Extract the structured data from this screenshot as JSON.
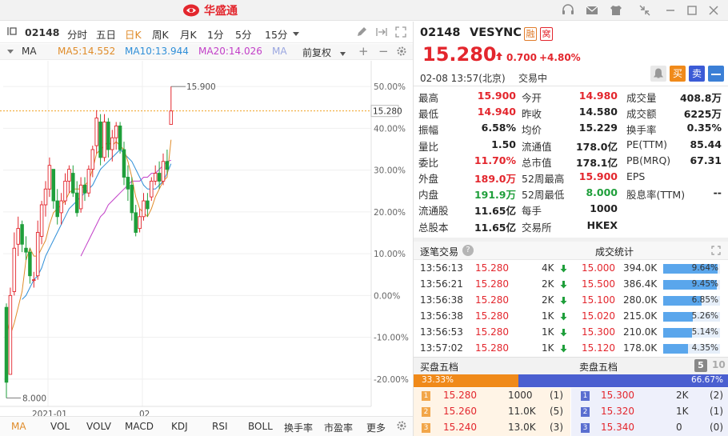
{
  "app": {
    "logo_text": "华盛通"
  },
  "toolbar": {
    "code": "02148",
    "periods": [
      "分时",
      "五日",
      "日K",
      "周K",
      "月K",
      "1分",
      "5分",
      "15分"
    ],
    "active_period": "日K"
  },
  "ma_bar": {
    "label": "MA",
    "ma5": "MA5:14.552",
    "ma10": "MA10:13.944",
    "ma20": "MA20:14.026",
    "ma_more": "MA",
    "adjust": "前复权",
    "colors": {
      "ma5": "#e08c2a",
      "ma10": "#2f8fd8",
      "ma20": "#c23fc8",
      "up": "#e3262d",
      "down": "#1f9f3b"
    }
  },
  "chart_data": {
    "type": "candlestick",
    "price_high_label": "15.900",
    "price_low_label": "8.000",
    "current_price_label": "15.280",
    "y_ticks": [
      "50.00%",
      "40.00%",
      "30.00%",
      "20.00%",
      "10.00%",
      "0.00%",
      "-10.00%",
      "-20.00%"
    ],
    "x_ticks": [
      "2021-01",
      "02"
    ],
    "candles": [
      [
        10.3,
        10.4,
        8.0,
        8.4
      ],
      [
        8.6,
        10.8,
        8.6,
        10.6
      ],
      [
        10.7,
        12.2,
        10.6,
        11.8
      ],
      [
        11.9,
        12.6,
        11.6,
        12.3
      ],
      [
        12.4,
        12.5,
        11.7,
        11.9
      ],
      [
        11.8,
        12.1,
        11.5,
        11.7
      ],
      [
        11.7,
        11.8,
        10.9,
        11.1
      ],
      [
        11.0,
        11.2,
        10.8,
        11.0
      ],
      [
        11.1,
        12.5,
        11.0,
        12.2
      ],
      [
        12.1,
        13.0,
        11.9,
        12.9
      ],
      [
        12.9,
        13.5,
        12.6,
        13.3
      ],
      [
        13.3,
        14.1,
        13.1,
        13.9
      ],
      [
        13.8,
        13.8,
        12.8,
        13.0
      ],
      [
        13.0,
        13.3,
        12.4,
        12.6
      ],
      [
        12.7,
        13.2,
        12.4,
        13.0
      ],
      [
        13.0,
        13.7,
        12.9,
        13.5
      ],
      [
        13.5,
        13.9,
        13.2,
        13.8
      ],
      [
        13.7,
        13.9,
        13.1,
        13.2
      ],
      [
        13.2,
        13.5,
        12.6,
        12.7
      ],
      [
        12.8,
        13.6,
        12.7,
        13.4
      ],
      [
        13.4,
        13.6,
        13.0,
        13.2
      ],
      [
        13.2,
        13.9,
        13.1,
        13.8
      ],
      [
        13.8,
        14.4,
        13.6,
        14.3
      ],
      [
        14.4,
        15.3,
        14.2,
        15.1
      ],
      [
        15.0,
        15.2,
        13.9,
        14.1
      ],
      [
        14.1,
        15.2,
        14.0,
        15.0
      ],
      [
        15.0,
        15.1,
        14.1,
        14.3
      ],
      [
        14.3,
        14.8,
        14.0,
        14.6
      ],
      [
        14.6,
        15.0,
        14.3,
        14.9
      ],
      [
        14.9,
        15.0,
        14.2,
        14.3
      ],
      [
        14.3,
        14.5,
        13.4,
        13.6
      ],
      [
        13.6,
        13.9,
        13.0,
        13.3
      ],
      [
        13.4,
        13.6,
        12.5,
        12.7
      ],
      [
        12.7,
        12.9,
        12.1,
        12.2
      ],
      [
        12.3,
        12.8,
        12.2,
        12.6
      ],
      [
        12.6,
        13.2,
        12.5,
        13.0
      ],
      [
        13.0,
        13.2,
        12.6,
        12.8
      ],
      [
        13.1,
        13.6,
        13.0,
        13.5
      ],
      [
        13.5,
        13.9,
        13.4,
        13.7
      ],
      [
        13.7,
        14.0,
        13.3,
        13.5
      ],
      [
        13.5,
        14.2,
        13.4,
        14.0
      ],
      [
        14.0,
        14.3,
        13.7,
        13.8
      ],
      [
        14.94,
        15.9,
        14.94,
        15.28
      ]
    ],
    "ma5_values": [
      10.0,
      9.6,
      9.9,
      10.3,
      10.7,
      11.5,
      11.8,
      11.6,
      11.6,
      11.8,
      12.0,
      12.4,
      12.7,
      12.8,
      12.9,
      13.0,
      13.2,
      13.3,
      13.3,
      13.3,
      13.4,
      13.5,
      13.8,
      14.2,
      14.3,
      14.4,
      14.5,
      14.4,
      14.5,
      14.4,
      14.3,
      14.0,
      13.6,
      13.1,
      12.8,
      12.7,
      12.6,
      12.8,
      13.1,
      13.3,
      13.5,
      13.6,
      14.55
    ],
    "ma10_values": [
      null,
      null,
      null,
      null,
      10.5,
      10.6,
      10.8,
      11.0,
      11.1,
      11.3,
      11.6,
      11.8,
      12.0,
      12.2,
      12.4,
      12.6,
      12.8,
      12.9,
      13.0,
      13.1,
      13.2,
      13.3,
      13.4,
      13.6,
      13.8,
      13.9,
      14.0,
      14.1,
      14.2,
      14.3,
      14.2,
      14.1,
      14.0,
      13.8,
      13.6,
      13.4,
      13.3,
      13.3,
      13.3,
      13.4,
      13.5,
      13.7,
      13.94
    ],
    "ma20_values": [
      null,
      null,
      null,
      null,
      null,
      null,
      null,
      null,
      null,
      null,
      null,
      null,
      null,
      null,
      null,
      null,
      null,
      null,
      null,
      11.6,
      11.8,
      12.0,
      12.2,
      12.4,
      12.6,
      12.7,
      12.9,
      13.0,
      13.1,
      13.2,
      13.3,
      13.4,
      13.5,
      13.5,
      13.5,
      13.6,
      13.6,
      13.7,
      13.7,
      13.8,
      13.9,
      14.0,
      14.03
    ]
  },
  "bottom_tabs": [
    "MA",
    "VOL",
    "VOLV",
    "MACD",
    "KDJ",
    "RSI",
    "BOLL",
    "换手率",
    "市盈率",
    "更多"
  ],
  "stock": {
    "code": "02148",
    "name": "VESYNC",
    "tag1": "融",
    "tag2": "窝",
    "price": "15.280",
    "change": "0.700",
    "change_pct": "+4.80%",
    "datetime": "02-08  13:57(北京)",
    "status": "交易中",
    "btn_buy": "买",
    "btn_sell": "卖"
  },
  "quote": [
    [
      {
        "label": "最高",
        "value": "15.900",
        "color": "#e3262d"
      },
      {
        "label": "今开",
        "value": "14.980",
        "color": "#e3262d"
      },
      {
        "label": "成交量",
        "value": "408.8万",
        "color": "#222"
      }
    ],
    [
      {
        "label": "最低",
        "value": "14.940",
        "color": "#e3262d"
      },
      {
        "label": "昨收",
        "value": "14.580",
        "color": "#222"
      },
      {
        "label": "成交额",
        "value": "6225万",
        "color": "#222"
      }
    ],
    [
      {
        "label": "振幅",
        "value": "6.58%",
        "color": "#222"
      },
      {
        "label": "均价",
        "value": "15.229",
        "color": "#222"
      },
      {
        "label": "换手率",
        "value": "0.35%",
        "color": "#222"
      }
    ],
    [
      {
        "label": "量比",
        "value": "1.50",
        "color": "#222"
      },
      {
        "label": "流通值",
        "value": "178.0亿",
        "color": "#222"
      },
      {
        "label": "PE(TTM)",
        "value": "85.44",
        "color": "#222"
      }
    ],
    [
      {
        "label": "委比",
        "value": "11.70%",
        "color": "#e3262d"
      },
      {
        "label": "总市值",
        "value": "178.1亿",
        "color": "#222"
      },
      {
        "label": "PB(MRQ)",
        "value": "67.31",
        "color": "#222"
      }
    ],
    [
      {
        "label": "外盘",
        "value": "189.0万",
        "color": "#e3262d"
      },
      {
        "label": "52周最高",
        "value": "15.900",
        "color": "#e3262d"
      },
      {
        "label": "EPS",
        "value": "",
        "color": "#222"
      }
    ],
    [
      {
        "label": "内盘",
        "value": "191.9万",
        "color": "#1f9f3b"
      },
      {
        "label": "52周最低",
        "value": "8.000",
        "color": "#1f9f3b"
      },
      {
        "label": "股息率(TTM)",
        "value": "--",
        "color": "#222"
      }
    ],
    [
      {
        "label": "流通股",
        "value": "11.65亿",
        "color": "#222"
      },
      {
        "label": "每手",
        "value": "1000",
        "color": "#222"
      },
      {
        "label": "",
        "value": "",
        "color": "#222"
      }
    ],
    [
      {
        "label": "总股本",
        "value": "11.65亿",
        "color": "#222"
      },
      {
        "label": "交易所",
        "value": "HKEX",
        "color": "#222"
      },
      {
        "label": "",
        "value": "",
        "color": "#222"
      }
    ]
  ],
  "trades": {
    "title": "逐笔交易",
    "stats_title": "成交统计",
    "rows": [
      {
        "time": "13:56:13",
        "price": "15.280",
        "vol": "4K",
        "sp": "15.000",
        "sv": "394.0K",
        "pct": "9.64%",
        "ratio": 0.96
      },
      {
        "time": "13:56:21",
        "price": "15.280",
        "vol": "2K",
        "sp": "15.500",
        "sv": "386.4K",
        "pct": "9.45%",
        "ratio": 0.94
      },
      {
        "time": "13:56:38",
        "price": "15.280",
        "vol": "2K",
        "sp": "15.100",
        "sv": "280.0K",
        "pct": "6.85%",
        "ratio": 0.68
      },
      {
        "time": "13:56:38",
        "price": "15.280",
        "vol": "1K",
        "sp": "15.020",
        "sv": "215.0K",
        "pct": "5.26%",
        "ratio": 0.52
      },
      {
        "time": "13:56:53",
        "price": "15.280",
        "vol": "1K",
        "sp": "15.300",
        "sv": "210.0K",
        "pct": "5.14%",
        "ratio": 0.51
      },
      {
        "time": "13:57:02",
        "price": "15.280",
        "vol": "1K",
        "sp": "15.120",
        "sv": "178.0K",
        "pct": "4.35%",
        "ratio": 0.43
      }
    ]
  },
  "depth": {
    "bid_title": "买盘五档",
    "ask_title": "卖盘五档",
    "level5": "5",
    "level10": "10",
    "bid_pct": "33.33%",
    "ask_pct": "66.67%",
    "bid_ratio": 0.3333,
    "bids": [
      {
        "lvl": "1",
        "price": "15.280",
        "vol": "1000",
        "cnt": "(1)"
      },
      {
        "lvl": "2",
        "price": "15.260",
        "vol": "11.0K",
        "cnt": "(5)"
      },
      {
        "lvl": "3",
        "price": "15.240",
        "vol": "13.0K",
        "cnt": "(3)"
      }
    ],
    "asks": [
      {
        "lvl": "1",
        "price": "15.300",
        "vol": "2K",
        "cnt": "(2)"
      },
      {
        "lvl": "2",
        "price": "15.320",
        "vol": "1K",
        "cnt": "(1)"
      },
      {
        "lvl": "3",
        "price": "15.340",
        "vol": "0",
        "cnt": "(0)"
      }
    ]
  }
}
